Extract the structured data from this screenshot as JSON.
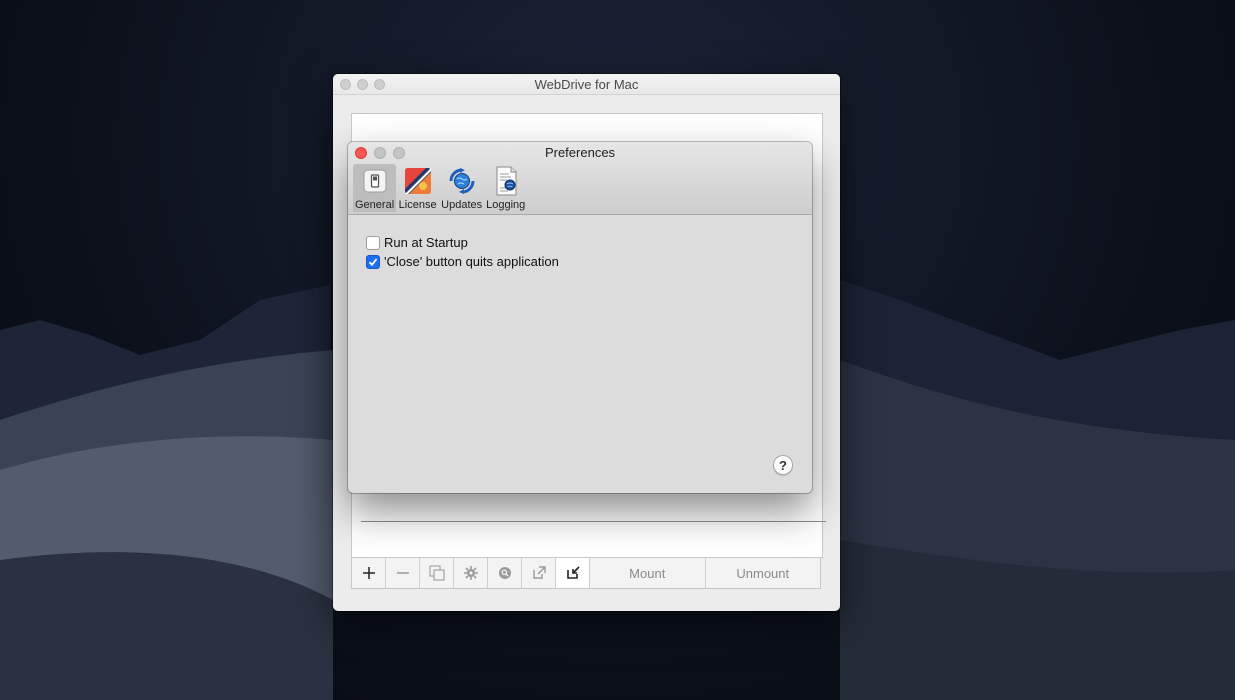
{
  "main_window": {
    "title": "WebDrive for Mac",
    "toolbar": {
      "add_icon": "plus-icon",
      "remove_icon": "minus-icon",
      "mount_label": "Mount",
      "unmount_label": "Unmount"
    }
  },
  "preferences": {
    "title": "Preferences",
    "tabs": [
      {
        "label": "General",
        "icon": "general-switch-icon",
        "selected": true
      },
      {
        "label": "License",
        "icon": "license-icon",
        "selected": false
      },
      {
        "label": "Updates",
        "icon": "updates-globe-icon",
        "selected": false
      },
      {
        "label": "Logging",
        "icon": "logging-document-icon",
        "selected": false
      }
    ],
    "options": [
      {
        "label": "Run at Startup",
        "checked": false
      },
      {
        "label": "'Close' button quits application",
        "checked": true
      }
    ],
    "help_label": "?"
  },
  "colors": {
    "close_red": "#fc5753",
    "checkbox_blue": "#1d6ef5"
  }
}
